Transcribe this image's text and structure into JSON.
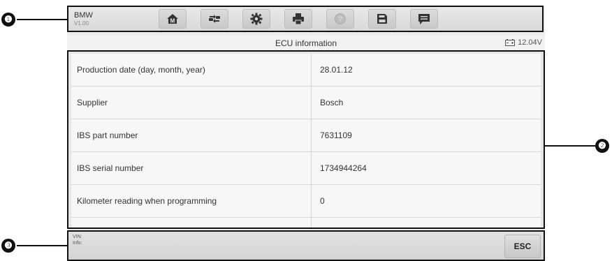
{
  "header": {
    "brand": "BMW",
    "version": "V1.00",
    "toolbar": [
      "home-icon",
      "vehicle-swap-icon",
      "settings-icon",
      "print-icon",
      "help-icon",
      "save-icon",
      "message-icon"
    ]
  },
  "titlebar": {
    "title": "ECU information",
    "voltage": "12.04V"
  },
  "table": {
    "rows": [
      {
        "label": "Production date (day, month, year)",
        "value": "28.01.12"
      },
      {
        "label": "Supplier",
        "value": "Bosch"
      },
      {
        "label": "IBS part number",
        "value": "7631109"
      },
      {
        "label": "IBS serial number",
        "value": "1734944264"
      },
      {
        "label": "Kilometer reading when programming",
        "value": "0"
      }
    ]
  },
  "footer": {
    "vin_label": "VIN:",
    "info_label": "Info:",
    "esc_label": "ESC"
  },
  "callouts": [
    "❶",
    "❷",
    "❸"
  ]
}
